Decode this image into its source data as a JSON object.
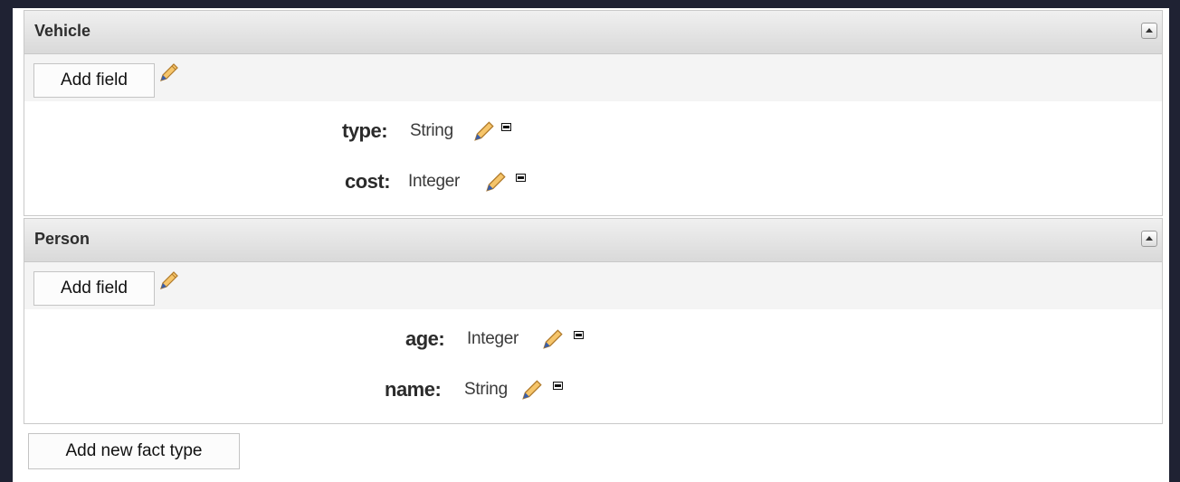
{
  "fact_types": [
    {
      "name": "Vehicle",
      "add_field_label": "Add field",
      "fields": [
        {
          "name": "type:",
          "type": "String"
        },
        {
          "name": "cost:",
          "type": "Integer"
        }
      ]
    },
    {
      "name": "Person",
      "add_field_label": "Add field",
      "fields": [
        {
          "name": "age:",
          "type": "Integer"
        },
        {
          "name": "name:",
          "type": "String"
        }
      ]
    }
  ],
  "add_fact_type_label": "Add new fact type",
  "icons": {
    "edit": "pencil-icon",
    "remove": "remove-icon",
    "collapse": "collapse-up-icon"
  }
}
